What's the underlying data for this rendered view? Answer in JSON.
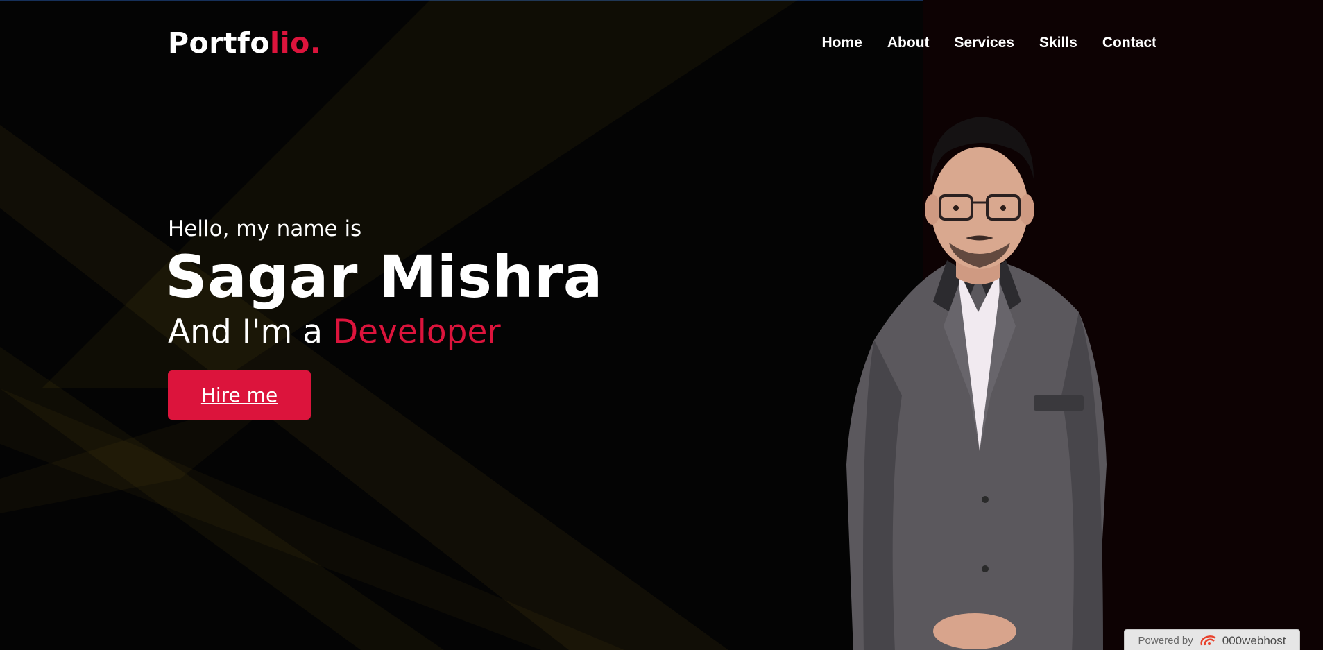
{
  "logo": {
    "main": "Portfo",
    "accent": "lio."
  },
  "nav": {
    "items": [
      {
        "label": "Home"
      },
      {
        "label": "About"
      },
      {
        "label": "Services"
      },
      {
        "label": "Skills"
      },
      {
        "label": "Contact"
      }
    ]
  },
  "hero": {
    "greeting": "Hello, my name is",
    "name": "Sagar Mishra",
    "role_prefix": "And I'm a ",
    "role_highlight": "Developer",
    "hire_button": "Hire me"
  },
  "footer_badge": {
    "powered_by": "Powered by",
    "host_name": "000webhost",
    "icon": "000webhost-logo-icon"
  },
  "colors": {
    "accent": "#dc143c",
    "background": "#040404",
    "right_panel": "#0d0203",
    "text": "#ffffff"
  }
}
